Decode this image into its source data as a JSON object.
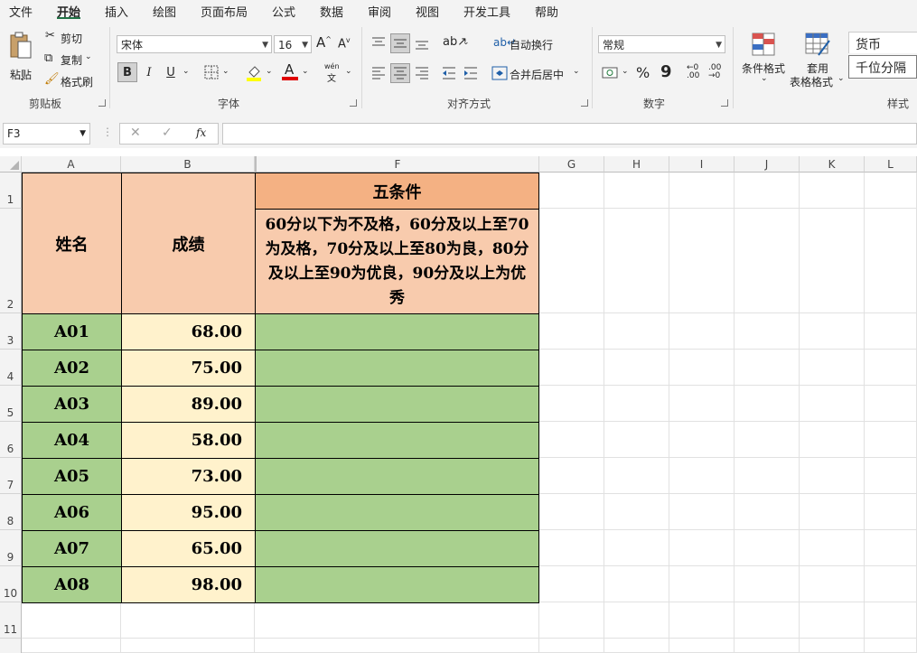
{
  "menu": {
    "tabs": [
      {
        "label": "文件"
      },
      {
        "label": "开始"
      },
      {
        "label": "插入"
      },
      {
        "label": "绘图"
      },
      {
        "label": "页面布局"
      },
      {
        "label": "公式"
      },
      {
        "label": "数据"
      },
      {
        "label": "审阅"
      },
      {
        "label": "视图"
      },
      {
        "label": "开发工具"
      },
      {
        "label": "帮助"
      }
    ],
    "active": "开始"
  },
  "ribbon": {
    "clipboard": {
      "paste": "粘贴",
      "cut": "剪切",
      "copy": "复制",
      "format_painter": "格式刷",
      "label": "剪贴板"
    },
    "font": {
      "font_name": "宋体",
      "font_size": "16",
      "bold": "B",
      "italic": "I",
      "underline": "U",
      "grow": "A",
      "shrink": "A",
      "font_color": "A",
      "phonetic_top": "wén",
      "phonetic_bottom": "文",
      "label": "字体",
      "fill_color": "#ffff00",
      "text_color": "#ff0000"
    },
    "alignment": {
      "wrap": "自动换行",
      "merge": "合并后居中",
      "label": "对齐方式"
    },
    "number": {
      "format": "常规",
      "percent": "%",
      "comma": "9",
      "label": "数字"
    },
    "styles": {
      "conditional": "条件格式",
      "table_format_1": "套用",
      "table_format_2": "表格格式",
      "currency": "货币",
      "thousands": "千位分隔",
      "label": "样式"
    }
  },
  "formula_bar": {
    "name_box": "F3",
    "cancel": "✕",
    "enter": "✓",
    "fx": "fx",
    "value": ""
  },
  "columns": [
    "A",
    "B",
    "F",
    "G",
    "H",
    "I",
    "J",
    "K",
    "L"
  ],
  "rows": [
    "1",
    "2",
    "3",
    "4",
    "5",
    "6",
    "7",
    "8",
    "9",
    "10",
    "11"
  ],
  "sheet": {
    "header_name": "姓名",
    "header_score": "成绩",
    "cond_title": "五条件",
    "cond_text": "60分以下为不及格，60分及以上至70为及格，70分及以上至80为良，80分及以上至90为优良，90分及以上为优秀",
    "records": [
      {
        "name": "A01",
        "score": "68.00"
      },
      {
        "name": "A02",
        "score": "75.00"
      },
      {
        "name": "A03",
        "score": "89.00"
      },
      {
        "name": "A04",
        "score": "58.00"
      },
      {
        "name": "A05",
        "score": "73.00"
      },
      {
        "name": "A06",
        "score": "95.00"
      },
      {
        "name": "A07",
        "score": "65.00"
      },
      {
        "name": "A08",
        "score": "98.00"
      }
    ]
  }
}
